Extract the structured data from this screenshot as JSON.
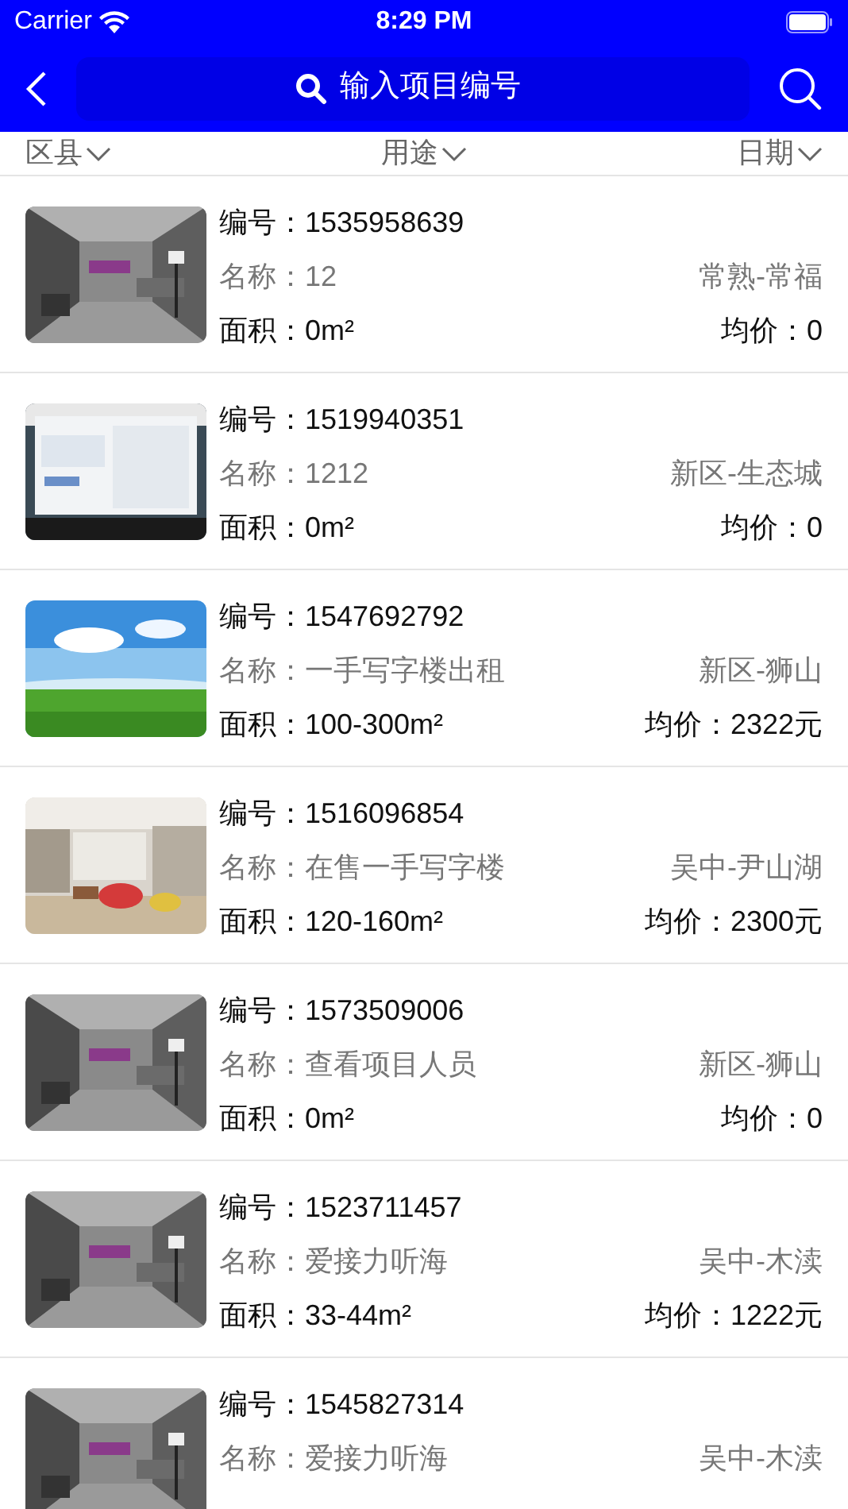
{
  "status_bar": {
    "carrier": "Carrier",
    "time": "8:29 PM"
  },
  "search": {
    "placeholder": "输入项目编号"
  },
  "filters": [
    {
      "label": "区县"
    },
    {
      "label": "用途"
    },
    {
      "label": "日期"
    }
  ],
  "listings": [
    {
      "number_label": "编号：",
      "number": "1535958639",
      "name_label": "名称：",
      "name": "12",
      "district": "常熟-常福",
      "area_label": "面积：",
      "area": "0m²",
      "price_label": "均价：",
      "price": "0"
    },
    {
      "number_label": "编号：",
      "number": "1519940351",
      "name_label": "名称：",
      "name": "1212",
      "district": "新区-生态城",
      "area_label": "面积：",
      "area": "0m²",
      "price_label": "均价：",
      "price": "0"
    },
    {
      "number_label": "编号：",
      "number": "1547692792",
      "name_label": "名称：",
      "name": "一手写字楼出租",
      "district": "新区-狮山",
      "area_label": "面积：",
      "area": "100-300m²",
      "price_label": "均价：",
      "price": "2322元"
    },
    {
      "number_label": "编号：",
      "number": "1516096854",
      "name_label": "名称：",
      "name": "在售一手写字楼",
      "district": "吴中-尹山湖",
      "area_label": "面积：",
      "area": "120-160m²",
      "price_label": "均价：",
      "price": "2300元"
    },
    {
      "number_label": "编号：",
      "number": "1573509006",
      "name_label": "名称：",
      "name": "查看项目人员",
      "district": "新区-狮山",
      "area_label": "面积：",
      "area": "0m²",
      "price_label": "均价：",
      "price": "0"
    },
    {
      "number_label": "编号：",
      "number": "1523711457",
      "name_label": "名称：",
      "name": "爱接力听海",
      "district": "吴中-木渎",
      "area_label": "面积：",
      "area": "33-44m²",
      "price_label": "均价：",
      "price": "1222元"
    },
    {
      "number_label": "编号：",
      "number": "1545827314",
      "name_label": "名称：",
      "name": "爱接力听海",
      "district": "吴中-木渎"
    }
  ]
}
